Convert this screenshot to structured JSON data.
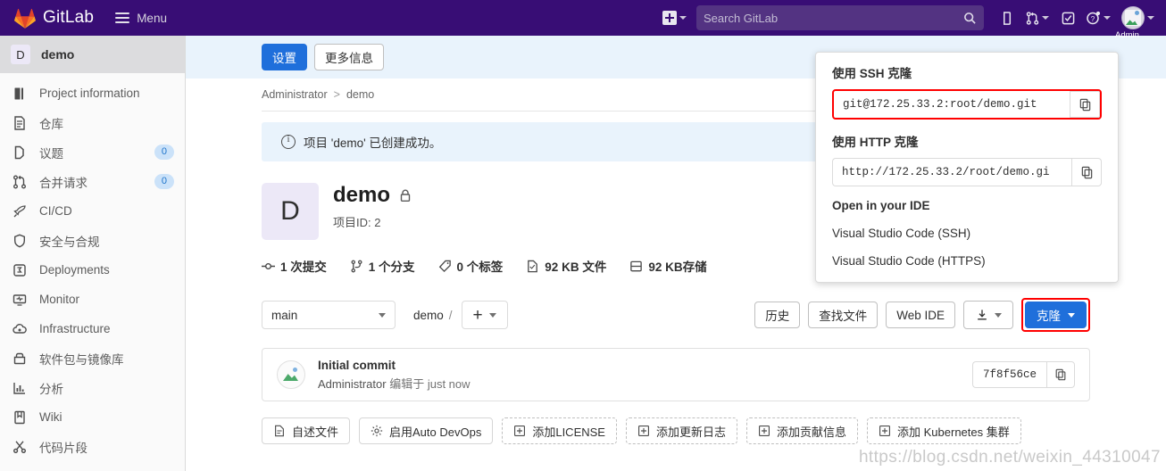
{
  "navbar": {
    "brand": "GitLab",
    "menu_label": "Menu",
    "search_placeholder": "Search GitLab",
    "icons": {
      "new": "plus-square-icon",
      "issues": "issues-icon",
      "merge_requests": "merge-request-icon",
      "todos": "todo-check-icon",
      "help": "question-circle-icon",
      "avatar": "user-avatar-broken-image"
    },
    "avatar_label": "Admin"
  },
  "sidebar": {
    "project": {
      "initial": "D",
      "name": "demo"
    },
    "items": [
      {
        "label": "Project information",
        "icon": "book-icon",
        "badge": ""
      },
      {
        "label": "仓库",
        "icon": "document-icon",
        "badge": ""
      },
      {
        "label": "议题",
        "icon": "issue-icon",
        "badge": "0"
      },
      {
        "label": "合并请求",
        "icon": "merge-request-icon",
        "badge": "0"
      },
      {
        "label": "CI/CD",
        "icon": "rocket-icon",
        "badge": ""
      },
      {
        "label": "安全与合规",
        "icon": "shield-icon",
        "badge": ""
      },
      {
        "label": "Deployments",
        "icon": "deployments-icon",
        "badge": ""
      },
      {
        "label": "Monitor",
        "icon": "monitor-icon",
        "badge": ""
      },
      {
        "label": "Infrastructure",
        "icon": "cloud-icon",
        "badge": ""
      },
      {
        "label": "软件包与镜像库",
        "icon": "package-icon",
        "badge": ""
      },
      {
        "label": "分析",
        "icon": "chart-icon",
        "badge": ""
      },
      {
        "label": "Wiki",
        "icon": "book-open-icon",
        "badge": ""
      },
      {
        "label": "代码片段",
        "icon": "scissors-icon",
        "badge": ""
      }
    ]
  },
  "top_band": {
    "settings_label": "设置",
    "more_info_label": "更多信息"
  },
  "breadcrumb": {
    "owner": "Administrator",
    "separator": ">",
    "project": "demo"
  },
  "alert": {
    "text": "项目 'demo' 已创建成功。",
    "icon": "info-circle-icon"
  },
  "project": {
    "initial": "D",
    "name": "demo",
    "visibility_icon": "lock-icon",
    "id_label": "项目ID: 2",
    "stats": [
      {
        "icon": "commit-icon",
        "label": "1 次提交"
      },
      {
        "icon": "branch-icon",
        "label": "1 个分支"
      },
      {
        "icon": "tag-icon",
        "label": "0 个标签"
      },
      {
        "icon": "file-icon",
        "label": "92 KB 文件"
      },
      {
        "icon": "storage-icon",
        "label": "92 KB存储"
      }
    ]
  },
  "repo_bar": {
    "branch": "main",
    "path_root": "demo",
    "path_separator": "/",
    "add_label": "+",
    "history_label": "历史",
    "find_file_label": "查找文件",
    "web_ide_label": "Web IDE",
    "download_icon": "download-icon",
    "clone_label": "克隆"
  },
  "commit": {
    "title": "Initial commit",
    "author": "Administrator",
    "action": "编辑于",
    "time": "just now",
    "sha": "7f8f56ce",
    "copy_icon": "copy-icon"
  },
  "bottom_actions": [
    {
      "label": "自述文件",
      "icon": "file-icon",
      "dashed": false
    },
    {
      "label": "启用Auto DevOps",
      "icon": "gear-icon",
      "dashed": false
    },
    {
      "label": "添加LICENSE",
      "icon": "plus-square-icon",
      "dashed": true
    },
    {
      "label": "添加更新日志",
      "icon": "plus-square-icon",
      "dashed": true
    },
    {
      "label": "添加贡献信息",
      "icon": "plus-square-icon",
      "dashed": true
    },
    {
      "label": "添加 Kubernetes 集群",
      "icon": "plus-square-icon",
      "dashed": true
    }
  ],
  "clone_panel": {
    "ssh_title": "使用 SSH 克隆",
    "ssh_url": "git@172.25.33.2:root/demo.git",
    "http_title": "使用 HTTP 克隆",
    "http_url": "http://172.25.33.2/root/demo.gi",
    "ide_title": "Open in your IDE",
    "ide_options": [
      "Visual Studio Code (SSH)",
      "Visual Studio Code (HTTPS)"
    ],
    "copy_icon": "copy-icon"
  },
  "watermark": "https://blog.csdn.net/weixin_44310047",
  "colors": {
    "navbar": "#380d75",
    "primary": "#1f6fdb",
    "highlight": "#ff0000",
    "alert_bg": "#e9f3fc",
    "badge_bg": "#cbe2f9",
    "badge_text": "#1f75cb"
  }
}
